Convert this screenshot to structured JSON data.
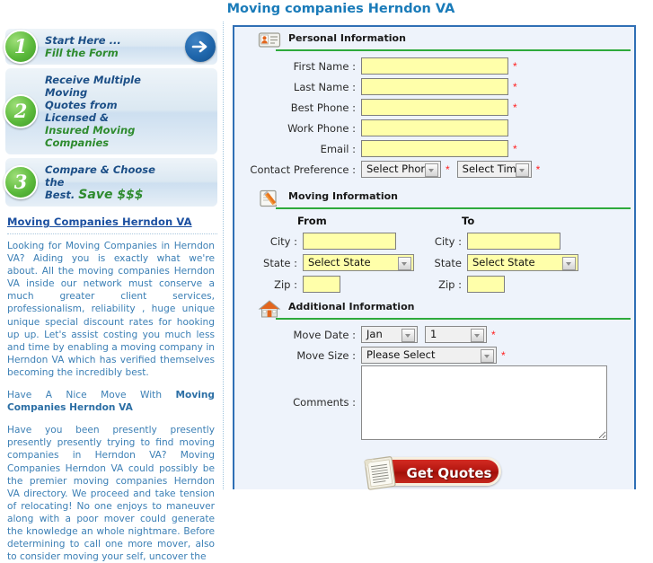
{
  "page": {
    "title": "Moving companies Herndon VA"
  },
  "sidebar": {
    "steps": [
      {
        "number": "1",
        "line1": "Start Here ...",
        "line2": "Fill the Form",
        "has_arrow": true,
        "arrow_icon": "arrow-right-icon"
      },
      {
        "number": "2",
        "line1": "Receive Multiple Moving",
        "line2": "Quotes from Licensed &",
        "line3": "Insured Moving Companies",
        "has_arrow": false
      },
      {
        "number": "3",
        "line1": "Compare & Choose the",
        "line2": "Best.",
        "line3_big": "Save $$$",
        "has_arrow": false
      }
    ],
    "link": "Moving Companies Herndon VA",
    "paragraphs": [
      "Looking for Moving Companies in Herndon VA? Aiding you is exactly what we're about. All the moving companies Herndon VA inside our network must conserve a much greater client services, professionalism, reliability , huge unique unique special discount rates for hooking up up. Let's assist costing you much less and time by enabling a moving company in Herndon VA which has verified themselves becoming the incredibly best.",
      "Have A Nice Move With Moving Companies Herndon VA",
      "Have you been presently presently presently presently trying to find moving companies in Herndon VA? Moving Companies Herndon VA could possibly be the premier moving companies Herndon VA directory. We proceed and take tension of relocating! No one enjoys to maneuver along with a poor mover could generate the knowledge an whole nightmare. Before determining to call one more mover, also to consider moving your self, uncover the"
    ],
    "paragraph2_plain": "Have A Nice Move With ",
    "paragraph2_bold": "Moving Companies Herndon VA"
  },
  "form": {
    "sections": [
      {
        "id": "personal",
        "title": "Personal Information",
        "icon": "contact-card-icon",
        "fields": [
          {
            "label": "First Name :",
            "type": "text",
            "value": "",
            "required": true
          },
          {
            "label": "Last Name :",
            "type": "text",
            "value": "",
            "required": true
          },
          {
            "label": "Best Phone :",
            "type": "text",
            "value": "",
            "required": true
          },
          {
            "label": "Work Phone :",
            "type": "text",
            "value": "",
            "required": false
          },
          {
            "label": "Email :",
            "type": "text",
            "value": "",
            "required": true
          }
        ],
        "contact_preference": {
          "label": "Contact Preference :",
          "phone_select": "Select Phone",
          "phone_required": true,
          "time_select": "Select Time",
          "time_required": true
        }
      },
      {
        "id": "moving",
        "title": "Moving Information",
        "icon": "pencil-notepad-icon",
        "from_header": "From",
        "to_header": "To",
        "from": {
          "city_label": "City :",
          "city_value": "",
          "state_label": "State :",
          "state_value": "Select State",
          "zip_label": "Zip :",
          "zip_value": ""
        },
        "to": {
          "city_label": "City :",
          "city_value": "",
          "state_label": "State",
          "state_value": "Select State",
          "zip_label": "Zip :",
          "zip_value": ""
        }
      },
      {
        "id": "additional",
        "title": "Additional Information",
        "icon": "house-icon",
        "move_date": {
          "label": "Move Date :",
          "month_value": "Jan",
          "day_value": "1",
          "required": true
        },
        "move_size": {
          "label": "Move Size :",
          "value": "Please Select",
          "required": true
        },
        "comments": {
          "label": "Comments :",
          "value": ""
        }
      }
    ],
    "submit": {
      "label": "Get Quotes",
      "icon": "clipboard-icon"
    },
    "required_marker": "*"
  },
  "colors": {
    "title_blue": "#1a7bb9",
    "panel_border": "#2f6fb5",
    "panel_bg": "#eef3fb",
    "rule_green": "#2eaa3c",
    "field_yellow": "#ffffaa",
    "required_red": "#ff2020",
    "badge_green": "#5cba3c",
    "arrow_blue": "#1f66ab",
    "link_blue": "#1b4fa0",
    "body_text_blue": "#3b7fb5",
    "button_red": "#b51711"
  }
}
